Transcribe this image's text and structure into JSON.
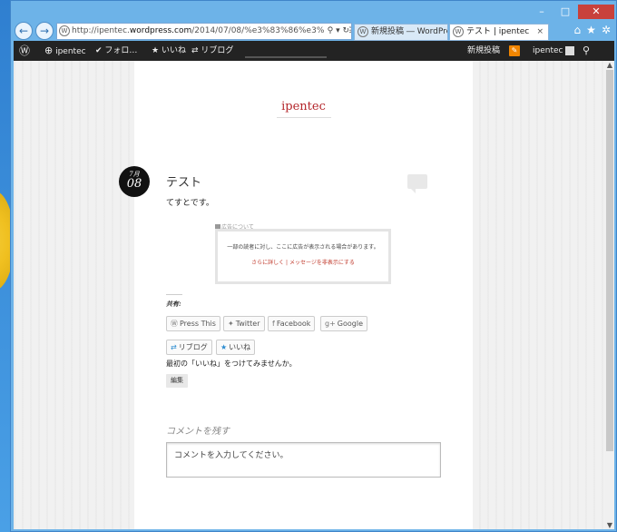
{
  "browser": {
    "address_host": "http://ipentec.",
    "address_bold": "wordpress.com",
    "address_path": "/2014/07/08/%e3%83%86%e3%82%b9%e",
    "address_icons": "⚲ ▾ ↻",
    "back_label": "←",
    "forward_label": "→",
    "tabs": [
      {
        "label": "新規投稿 ― WordPres…"
      },
      {
        "label": "テスト | ipentec",
        "close": "×"
      }
    ],
    "right_icons": [
      "⌂",
      "★",
      "✲"
    ],
    "window_controls": [
      "–",
      "□",
      "✕"
    ]
  },
  "adminbar": {
    "wp_logo": "Ⓦ",
    "site_name": "ipentec",
    "follow_label": "フォロ…",
    "like_label": "いいね",
    "reblog_label": "リブログ",
    "new_post_label": "新規投稿",
    "user_label": "ipentec"
  },
  "site": {
    "title": "ipentec"
  },
  "post": {
    "month": "7月",
    "day": "08",
    "title": "テスト",
    "body": "てすとです。"
  },
  "ad": {
    "about": "広告について",
    "notice": "一部の読者に対し、ここに広告が表示される場合があります。",
    "links": "さらに詳しく | メッセージを非表示にする"
  },
  "share": {
    "heading": "共有:",
    "buttons": [
      {
        "icon": "Ⓦ",
        "label": "Press This"
      },
      {
        "icon": "🐦",
        "label": "Twitter"
      },
      {
        "icon": "f",
        "label": "Facebook"
      },
      {
        "icon": "g+",
        "label": "Google"
      }
    ],
    "reblog_label": "リブログ",
    "like_label": "いいね",
    "first_like": "最初の「いいね」をつけてみませんか。",
    "edit_label": "編集"
  },
  "comments": {
    "heading": "コメントを残す",
    "placeholder": "コメントを入力してください。"
  }
}
